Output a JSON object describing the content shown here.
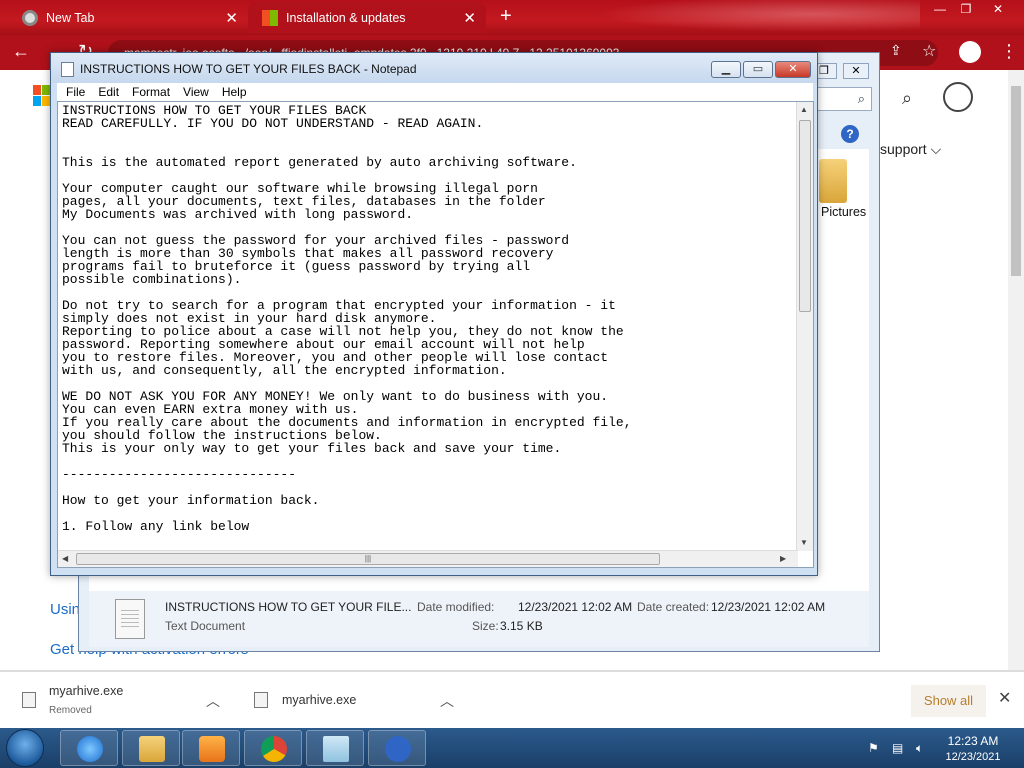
{
  "browser": {
    "tabs": [
      {
        "label": "New Tab"
      },
      {
        "label": "Installation & updates"
      }
    ],
    "new_tab_symbol": "+",
    "url": "mamsostr..ioo.osofto.../ooo/...ffiodinstalloti..ompdates.2f0...1219.210.l.49.7...12.25101369093",
    "accent_color": "#b0111a"
  },
  "webpage": {
    "support_text": "support ⌵",
    "link_using": "Usin",
    "link_gethelp": "Get help with activation errors",
    "link_color": "#1a6cc9"
  },
  "explorer": {
    "search_icon": "search-icon",
    "help_label": "?",
    "pictures_label": "Pictures",
    "details": {
      "file_name": "INSTRUCTIONS HOW TO GET YOUR FILE...",
      "file_type": "Text Document",
      "date_modified_label": "Date modified:",
      "date_modified_value": "12/23/2021 12:02 AM",
      "date_created_label": "Date created:",
      "date_created_value": "12/23/2021 12:02 AM",
      "size_label": "Size:",
      "size_value": "3.15 KB"
    }
  },
  "notepad": {
    "title": "INSTRUCTIONS HOW TO GET YOUR FILES BACK - Notepad",
    "menu": [
      "File",
      "Edit",
      "Format",
      "View",
      "Help"
    ],
    "content": "INSTRUCTIONS HOW TO GET YOUR FILES BACK\nREAD CAREFULLY. IF YOU DO NOT UNDERSTAND - READ AGAIN.\n\n\nThis is the automated report generated by auto archiving software.\n\nYour computer caught our software while browsing illegal porn\npages, all your documents, text files, databases in the folder\nMy Documents was archived with long password.\n\nYou can not guess the password for your archived files - password\nlength is more than 30 symbols that makes all password recovery\nprograms fail to bruteforce it (guess password by trying all\npossible combinations).\n\nDo not try to search for a program that encrypted your information - it\nsimply does not exist in your hard disk anymore.\nReporting to police about a case will not help you, they do not know the\npassword. Reporting somewhere about our email account will not help\nyou to restore files. Moreover, you and other people will lose contact\nwith us, and consequently, all the encrypted information.\n\nWE DO NOT ASK YOU FOR ANY MONEY! We only want to do business with you.\nYou can even EARN extra money with us.\nIf you really care about the documents and information in encrypted file,\nyou should follow the instructions below.\nThis is your only way to get your files back and save your time.\n\n------------------------------\n\nHow to get your information back.\n\n1. Follow any link below"
  },
  "downloads": {
    "items": [
      {
        "name": "myarhive.exe",
        "status": "Removed"
      },
      {
        "name": "myarhive.exe",
        "status": ""
      }
    ],
    "show_all": "Show all",
    "close": "✕"
  },
  "taskbar": {
    "time": "12:23 AM",
    "date": "12/23/2021",
    "apps": [
      "internet-explorer",
      "file-explorer",
      "media-player",
      "chrome",
      "notepad",
      "help"
    ]
  }
}
